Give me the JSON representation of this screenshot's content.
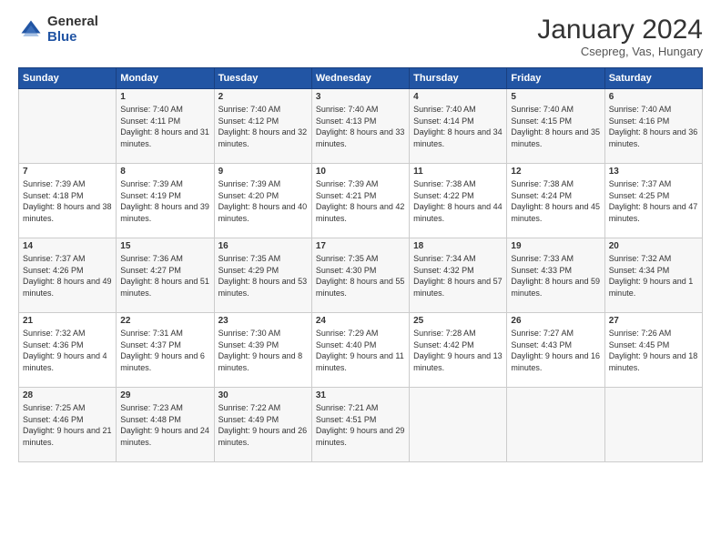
{
  "logo": {
    "general": "General",
    "blue": "Blue"
  },
  "header": {
    "month_year": "January 2024",
    "location": "Csepreg, Vas, Hungary"
  },
  "days_of_week": [
    "Sunday",
    "Monday",
    "Tuesday",
    "Wednesday",
    "Thursday",
    "Friday",
    "Saturday"
  ],
  "weeks": [
    [
      {
        "day": "",
        "sunrise": "",
        "sunset": "",
        "daylight": ""
      },
      {
        "day": "1",
        "sunrise": "Sunrise: 7:40 AM",
        "sunset": "Sunset: 4:11 PM",
        "daylight": "Daylight: 8 hours and 31 minutes."
      },
      {
        "day": "2",
        "sunrise": "Sunrise: 7:40 AM",
        "sunset": "Sunset: 4:12 PM",
        "daylight": "Daylight: 8 hours and 32 minutes."
      },
      {
        "day": "3",
        "sunrise": "Sunrise: 7:40 AM",
        "sunset": "Sunset: 4:13 PM",
        "daylight": "Daylight: 8 hours and 33 minutes."
      },
      {
        "day": "4",
        "sunrise": "Sunrise: 7:40 AM",
        "sunset": "Sunset: 4:14 PM",
        "daylight": "Daylight: 8 hours and 34 minutes."
      },
      {
        "day": "5",
        "sunrise": "Sunrise: 7:40 AM",
        "sunset": "Sunset: 4:15 PM",
        "daylight": "Daylight: 8 hours and 35 minutes."
      },
      {
        "day": "6",
        "sunrise": "Sunrise: 7:40 AM",
        "sunset": "Sunset: 4:16 PM",
        "daylight": "Daylight: 8 hours and 36 minutes."
      }
    ],
    [
      {
        "day": "7",
        "sunrise": "Sunrise: 7:39 AM",
        "sunset": "Sunset: 4:18 PM",
        "daylight": "Daylight: 8 hours and 38 minutes."
      },
      {
        "day": "8",
        "sunrise": "Sunrise: 7:39 AM",
        "sunset": "Sunset: 4:19 PM",
        "daylight": "Daylight: 8 hours and 39 minutes."
      },
      {
        "day": "9",
        "sunrise": "Sunrise: 7:39 AM",
        "sunset": "Sunset: 4:20 PM",
        "daylight": "Daylight: 8 hours and 40 minutes."
      },
      {
        "day": "10",
        "sunrise": "Sunrise: 7:39 AM",
        "sunset": "Sunset: 4:21 PM",
        "daylight": "Daylight: 8 hours and 42 minutes."
      },
      {
        "day": "11",
        "sunrise": "Sunrise: 7:38 AM",
        "sunset": "Sunset: 4:22 PM",
        "daylight": "Daylight: 8 hours and 44 minutes."
      },
      {
        "day": "12",
        "sunrise": "Sunrise: 7:38 AM",
        "sunset": "Sunset: 4:24 PM",
        "daylight": "Daylight: 8 hours and 45 minutes."
      },
      {
        "day": "13",
        "sunrise": "Sunrise: 7:37 AM",
        "sunset": "Sunset: 4:25 PM",
        "daylight": "Daylight: 8 hours and 47 minutes."
      }
    ],
    [
      {
        "day": "14",
        "sunrise": "Sunrise: 7:37 AM",
        "sunset": "Sunset: 4:26 PM",
        "daylight": "Daylight: 8 hours and 49 minutes."
      },
      {
        "day": "15",
        "sunrise": "Sunrise: 7:36 AM",
        "sunset": "Sunset: 4:27 PM",
        "daylight": "Daylight: 8 hours and 51 minutes."
      },
      {
        "day": "16",
        "sunrise": "Sunrise: 7:35 AM",
        "sunset": "Sunset: 4:29 PM",
        "daylight": "Daylight: 8 hours and 53 minutes."
      },
      {
        "day": "17",
        "sunrise": "Sunrise: 7:35 AM",
        "sunset": "Sunset: 4:30 PM",
        "daylight": "Daylight: 8 hours and 55 minutes."
      },
      {
        "day": "18",
        "sunrise": "Sunrise: 7:34 AM",
        "sunset": "Sunset: 4:32 PM",
        "daylight": "Daylight: 8 hours and 57 minutes."
      },
      {
        "day": "19",
        "sunrise": "Sunrise: 7:33 AM",
        "sunset": "Sunset: 4:33 PM",
        "daylight": "Daylight: 8 hours and 59 minutes."
      },
      {
        "day": "20",
        "sunrise": "Sunrise: 7:32 AM",
        "sunset": "Sunset: 4:34 PM",
        "daylight": "Daylight: 9 hours and 1 minute."
      }
    ],
    [
      {
        "day": "21",
        "sunrise": "Sunrise: 7:32 AM",
        "sunset": "Sunset: 4:36 PM",
        "daylight": "Daylight: 9 hours and 4 minutes."
      },
      {
        "day": "22",
        "sunrise": "Sunrise: 7:31 AM",
        "sunset": "Sunset: 4:37 PM",
        "daylight": "Daylight: 9 hours and 6 minutes."
      },
      {
        "day": "23",
        "sunrise": "Sunrise: 7:30 AM",
        "sunset": "Sunset: 4:39 PM",
        "daylight": "Daylight: 9 hours and 8 minutes."
      },
      {
        "day": "24",
        "sunrise": "Sunrise: 7:29 AM",
        "sunset": "Sunset: 4:40 PM",
        "daylight": "Daylight: 9 hours and 11 minutes."
      },
      {
        "day": "25",
        "sunrise": "Sunrise: 7:28 AM",
        "sunset": "Sunset: 4:42 PM",
        "daylight": "Daylight: 9 hours and 13 minutes."
      },
      {
        "day": "26",
        "sunrise": "Sunrise: 7:27 AM",
        "sunset": "Sunset: 4:43 PM",
        "daylight": "Daylight: 9 hours and 16 minutes."
      },
      {
        "day": "27",
        "sunrise": "Sunrise: 7:26 AM",
        "sunset": "Sunset: 4:45 PM",
        "daylight": "Daylight: 9 hours and 18 minutes."
      }
    ],
    [
      {
        "day": "28",
        "sunrise": "Sunrise: 7:25 AM",
        "sunset": "Sunset: 4:46 PM",
        "daylight": "Daylight: 9 hours and 21 minutes."
      },
      {
        "day": "29",
        "sunrise": "Sunrise: 7:23 AM",
        "sunset": "Sunset: 4:48 PM",
        "daylight": "Daylight: 9 hours and 24 minutes."
      },
      {
        "day": "30",
        "sunrise": "Sunrise: 7:22 AM",
        "sunset": "Sunset: 4:49 PM",
        "daylight": "Daylight: 9 hours and 26 minutes."
      },
      {
        "day": "31",
        "sunrise": "Sunrise: 7:21 AM",
        "sunset": "Sunset: 4:51 PM",
        "daylight": "Daylight: 9 hours and 29 minutes."
      },
      {
        "day": "",
        "sunrise": "",
        "sunset": "",
        "daylight": ""
      },
      {
        "day": "",
        "sunrise": "",
        "sunset": "",
        "daylight": ""
      },
      {
        "day": "",
        "sunrise": "",
        "sunset": "",
        "daylight": ""
      }
    ]
  ]
}
